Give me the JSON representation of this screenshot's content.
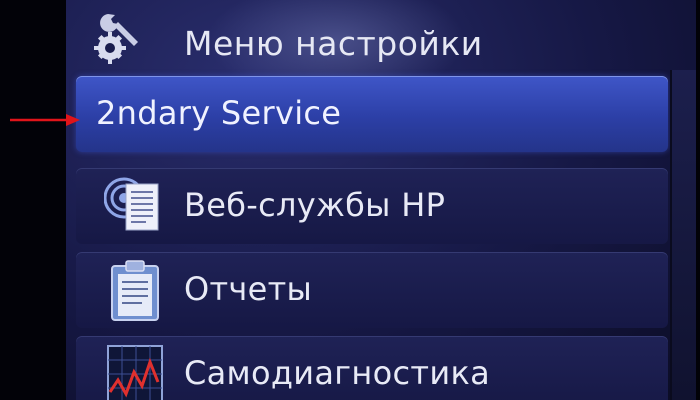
{
  "header": {
    "title": "Меню настройки",
    "icon": "wrench-gear-icon"
  },
  "menu": {
    "items": [
      {
        "label": "2ndary Service",
        "selected": true
      },
      {
        "label": "Веб-службы HP",
        "icon": "web-services-icon"
      },
      {
        "label": "Отчеты",
        "icon": "clipboard-report-icon"
      },
      {
        "label": "Самодиагностика",
        "icon": "diagnostics-chart-icon"
      }
    ]
  },
  "colors": {
    "selected": "#3f56c8",
    "item_bg": "#1f2256",
    "arrow": "#e0141a"
  }
}
